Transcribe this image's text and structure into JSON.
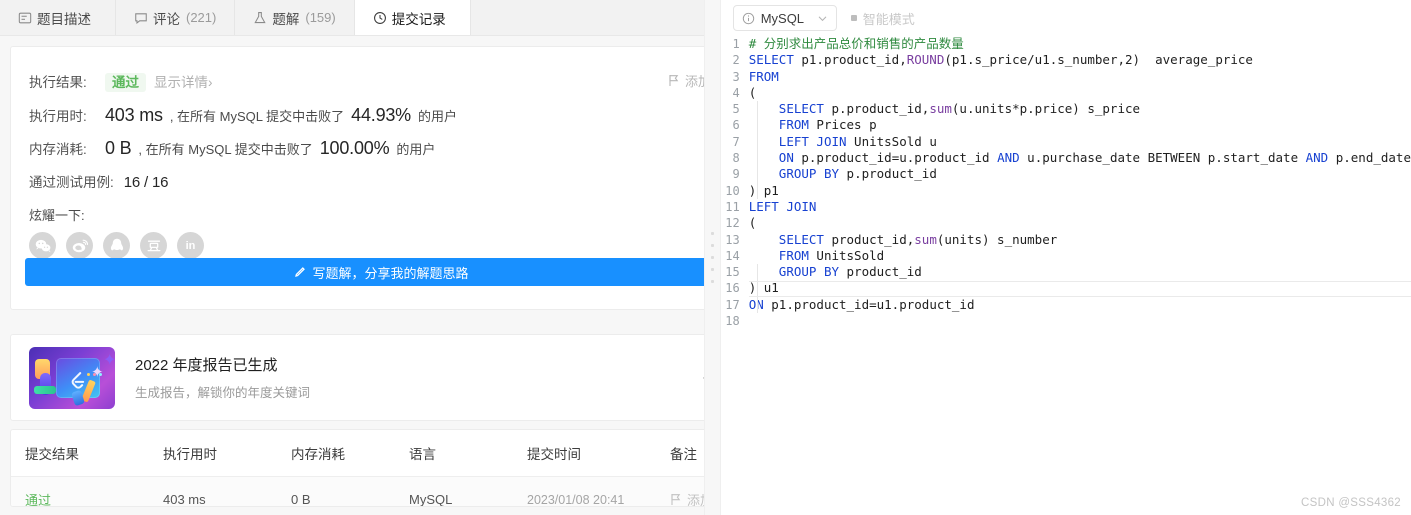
{
  "tabs": [
    {
      "label": "题目描述",
      "count": "",
      "icon": "description-icon",
      "active": false
    },
    {
      "label": "评论",
      "count": "(221)",
      "icon": "comment-icon",
      "active": false
    },
    {
      "label": "题解",
      "count": "(159)",
      "icon": "flask-icon",
      "active": false
    },
    {
      "label": "提交记录",
      "count": "",
      "icon": "clock-icon",
      "active": true
    }
  ],
  "result": {
    "add_note_label": "添加备注",
    "exec_result_label": "执行结果:",
    "status_badge": "通过",
    "show_detail_label": "显示详情",
    "show_detail_chevron": "›",
    "exec_time_label": "执行用时:",
    "exec_time_value": "403 ms",
    "exec_time_mid": ", 在所有 MySQL 提交中击败了",
    "exec_time_percent": "44.93%",
    "exec_time_suffix": "的用户",
    "memory_label": "内存消耗:",
    "memory_value": "0 B",
    "memory_mid": ", 在所有 MySQL 提交中击败了",
    "memory_percent": "100.00%",
    "memory_suffix": "的用户",
    "testcase_label": "通过测试用例:",
    "testcase_value": "16 / 16",
    "share_label": "炫耀一下:",
    "socials": [
      {
        "name": "wechat-icon"
      },
      {
        "name": "weibo-icon"
      },
      {
        "name": "qq-icon"
      },
      {
        "name": "douban-icon"
      },
      {
        "name": "linkedin-icon"
      }
    ],
    "write_solution_button": "写题解，分享我的解题思路"
  },
  "banner": {
    "title": "2022 年度报告已生成",
    "subtitle": "生成报告，解锁你的年度关键词",
    "arrow": "arrow-right-icon"
  },
  "table": {
    "headers": [
      "提交结果",
      "执行用时",
      "内存消耗",
      "语言",
      "提交时间",
      "备注"
    ],
    "rows": [
      {
        "result": "通过",
        "time": "403 ms",
        "memory": "0 B",
        "language": "MySQL",
        "submitted_at": "2023/01/08 20:41",
        "note": "添加备注"
      }
    ]
  },
  "editor": {
    "language": "MySQL",
    "smart_mode": "智能模式",
    "lines": [
      {
        "n": 1,
        "tokens": [
          {
            "t": "# 分别求出产品总价和销售的产品数量",
            "c": "cm"
          }
        ]
      },
      {
        "n": 2,
        "tokens": [
          {
            "t": "SELECT",
            "c": "kw"
          },
          {
            "t": " p1.product_id,",
            "c": ""
          },
          {
            "t": "ROUND",
            "c": "fn"
          },
          {
            "t": "(p1.s_price/u1.s_number,",
            "c": ""
          },
          {
            "t": "2",
            "c": "num"
          },
          {
            "t": ")  average_price",
            "c": ""
          }
        ]
      },
      {
        "n": 3,
        "tokens": [
          {
            "t": "FROM",
            "c": "kw"
          }
        ]
      },
      {
        "n": 4,
        "tokens": [
          {
            "t": "(",
            "c": ""
          }
        ]
      },
      {
        "n": 5,
        "tokens": [
          {
            "t": "    ",
            "c": ""
          },
          {
            "t": "SELECT",
            "c": "kw"
          },
          {
            "t": " p.product_id,",
            "c": ""
          },
          {
            "t": "sum",
            "c": "fn"
          },
          {
            "t": "(u.units*p.price) s_price",
            "c": ""
          }
        ]
      },
      {
        "n": 6,
        "tokens": [
          {
            "t": "    ",
            "c": ""
          },
          {
            "t": "FROM",
            "c": "kw"
          },
          {
            "t": " Prices p",
            "c": ""
          }
        ]
      },
      {
        "n": 7,
        "tokens": [
          {
            "t": "    ",
            "c": ""
          },
          {
            "t": "LEFT JOIN",
            "c": "kw"
          },
          {
            "t": " UnitsSold u",
            "c": ""
          }
        ]
      },
      {
        "n": 8,
        "tokens": [
          {
            "t": "    ",
            "c": ""
          },
          {
            "t": "ON",
            "c": "kw"
          },
          {
            "t": " p.product_id=u.product_id ",
            "c": ""
          },
          {
            "t": "AND",
            "c": "kw"
          },
          {
            "t": " u.purchase_date BETWEEN p.start_date ",
            "c": ""
          },
          {
            "t": "AND",
            "c": "kw"
          },
          {
            "t": " p.end_date",
            "c": ""
          }
        ]
      },
      {
        "n": 9,
        "tokens": [
          {
            "t": "    ",
            "c": ""
          },
          {
            "t": "GROUP BY",
            "c": "kw"
          },
          {
            "t": " p.product_id",
            "c": ""
          }
        ]
      },
      {
        "n": 10,
        "tokens": [
          {
            "t": ") p1",
            "c": ""
          }
        ]
      },
      {
        "n": 11,
        "tokens": [
          {
            "t": "LEFT JOIN",
            "c": "kw"
          }
        ]
      },
      {
        "n": 12,
        "tokens": [
          {
            "t": "(",
            "c": ""
          }
        ]
      },
      {
        "n": 13,
        "tokens": [
          {
            "t": "    ",
            "c": ""
          },
          {
            "t": "SELECT",
            "c": "kw"
          },
          {
            "t": " product_id,",
            "c": ""
          },
          {
            "t": "sum",
            "c": "fn"
          },
          {
            "t": "(units) s_number",
            "c": ""
          }
        ]
      },
      {
        "n": 14,
        "tokens": [
          {
            "t": "    ",
            "c": ""
          },
          {
            "t": "FROM",
            "c": "kw"
          },
          {
            "t": " UnitsSold",
            "c": ""
          }
        ]
      },
      {
        "n": 15,
        "tokens": [
          {
            "t": "    ",
            "c": ""
          },
          {
            "t": "GROUP BY",
            "c": "kw"
          },
          {
            "t": " product_id",
            "c": ""
          }
        ]
      },
      {
        "n": 16,
        "tokens": [
          {
            "t": ") u1",
            "c": ""
          }
        ]
      },
      {
        "n": 17,
        "tokens": [
          {
            "t": "ON",
            "c": "kw"
          },
          {
            "t": " p1.product_id=u1.product_id",
            "c": ""
          }
        ]
      },
      {
        "n": 18,
        "tokens": [
          {
            "t": "",
            "c": ""
          }
        ]
      }
    ]
  },
  "watermark": "CSDN @SSS4362",
  "colors": {
    "accent": "#1890ff",
    "pass_green": "#5cb85c",
    "keyword_blue": "#1741d1",
    "comment_green": "#2f8a3f",
    "function_purple": "#7a3fa0"
  }
}
